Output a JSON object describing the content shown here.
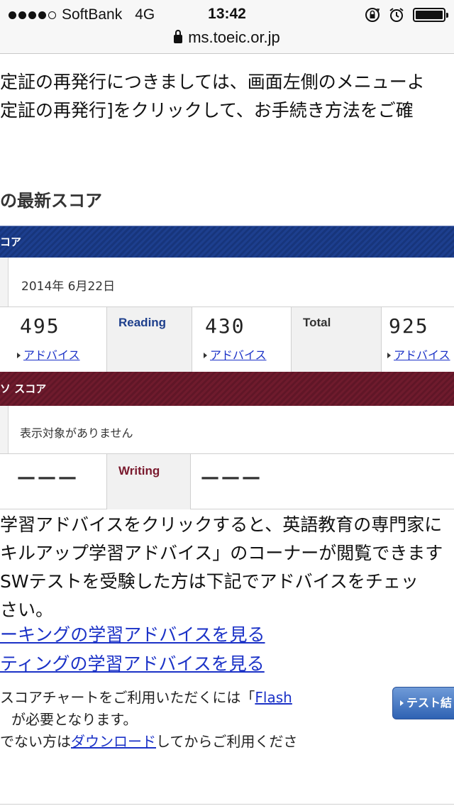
{
  "status_bar": {
    "carrier": "SoftBank",
    "network": "4G",
    "time": "13:42",
    "icons": [
      "signal-dots",
      "rotation-lock-icon",
      "alarm-icon",
      "battery-icon"
    ]
  },
  "browser": {
    "url": "ms.toeic.or.jp"
  },
  "intro": {
    "line1": "定証の再発行につきましては、画面左側のメニューよ",
    "line2": "定証の再発行]をクリックして、お手続き方法をご確"
  },
  "section_title": "の最新スコア",
  "lr": {
    "header": "コア",
    "date": "2014年 6月22日",
    "listening_score": "495",
    "reading_label": "Reading",
    "reading_score": "430",
    "total_label": "Total",
    "total_score": "925",
    "advice_label": "アドバイス"
  },
  "sw": {
    "header": "ソ スコア",
    "no_data": "表示対象がありません",
    "speaking_score": "———",
    "writing_label": "Writing",
    "writing_score": "———"
  },
  "paragraph": {
    "line1": "学習アドバイスをクリックすると、英語教育の専門家に",
    "line2": "キルアップ学習アドバイス」のコーナーが閲覧できます",
    "line3": "SWテストを受験した方は下記でアドバイスをチェッ",
    "line4": "さい。"
  },
  "links": {
    "speaking": "ーキングの学習アドバイスを見る",
    "writing": "ティングの学習アドバイスを見る"
  },
  "notes": {
    "line1_pre": "スコアチャートをご利用いただくには「",
    "flash": "Flash",
    "line2": "が必要となります。",
    "line3_pre": "でない方は",
    "download": "ダウンロード",
    "line3_post": "してからご利用くださ"
  },
  "button": {
    "label": "テスト結"
  },
  "colors": {
    "lr_bar": "#1d3f8e",
    "sw_bar": "#6f1b2d",
    "link": "#1b32c7"
  }
}
